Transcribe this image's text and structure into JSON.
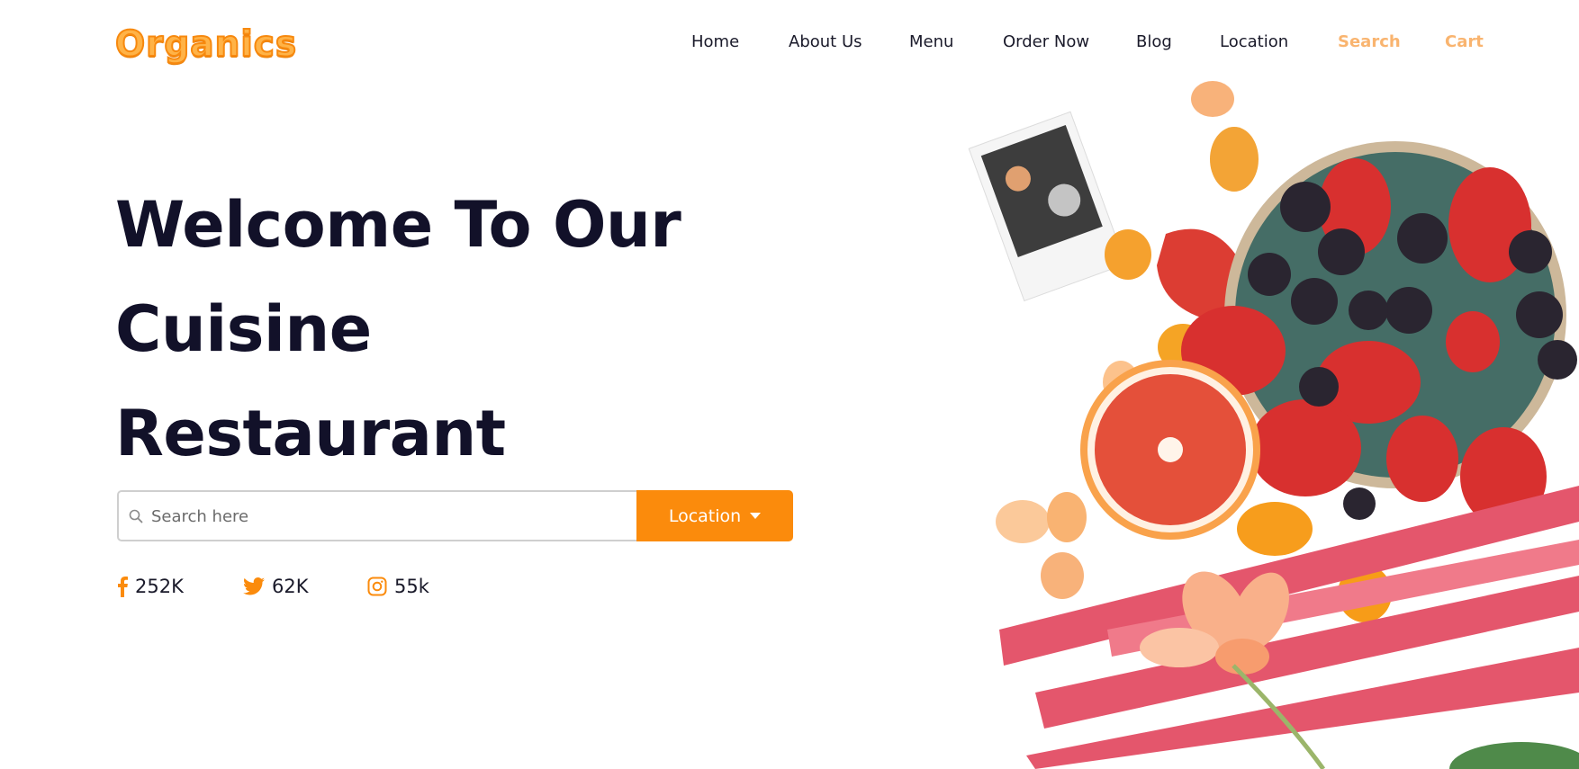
{
  "brand": {
    "logo_text": "Organics"
  },
  "nav": {
    "items": [
      {
        "label": "Home"
      },
      {
        "label": "About Us"
      },
      {
        "label": "Menu"
      },
      {
        "label": "Order Now"
      },
      {
        "label": "Blog"
      },
      {
        "label": "Location"
      }
    ],
    "search_label": "Search",
    "cart_label": "Cart"
  },
  "hero": {
    "title_lines": [
      "Welcome To Our",
      "Cuisine",
      "Restaurant"
    ],
    "search": {
      "placeholder": "Search here",
      "value": ""
    },
    "location_button": "Location"
  },
  "social": [
    {
      "icon": "facebook-icon",
      "count": "252K"
    },
    {
      "icon": "twitter-icon",
      "count": "62K"
    },
    {
      "icon": "instagram-icon",
      "count": "55k"
    }
  ],
  "colors": {
    "accent": "#fb8b0c",
    "accent_light": "#f9b46f",
    "heading": "#121129",
    "text": "#1a1a2a"
  }
}
